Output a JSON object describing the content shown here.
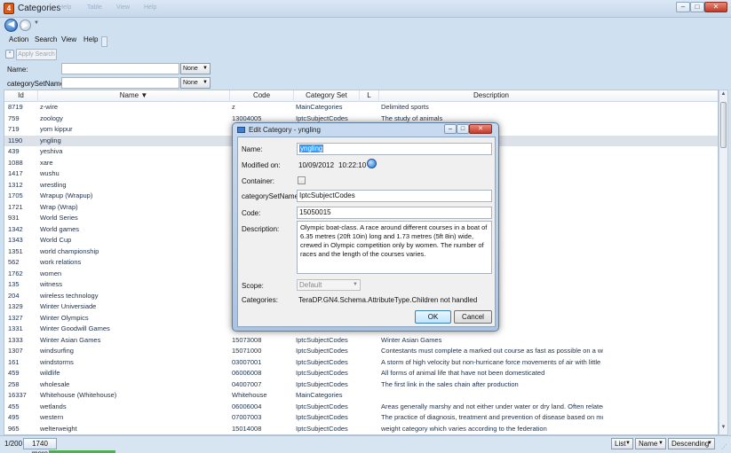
{
  "window": {
    "title": "Categories",
    "ghost_menu": [
      "Action",
      "Help",
      "Table",
      "View",
      "Help"
    ],
    "minimize": "–",
    "maximize": "□",
    "close": "✕"
  },
  "nav": {
    "back": "◀",
    "forward": "▶",
    "dropdown": "▼"
  },
  "menu": [
    "Action",
    "Search",
    "View",
    "Help"
  ],
  "filter": {
    "collapse": "^",
    "apply_label": "Apply Search",
    "name_label": "Name:",
    "name_mode": "None",
    "setname_label": "categorySetName:",
    "setname_mode": "None"
  },
  "grid": {
    "headers": {
      "id": "Id",
      "name": "Name ▼",
      "code": "Code",
      "set": "Category Set",
      "l": "L",
      "desc": "Description"
    },
    "rows": [
      {
        "id": "8719",
        "name": "z-wire",
        "code": "z",
        "set": "MainCategories",
        "desc": "Delimited sports"
      },
      {
        "id": "759",
        "name": "zoology",
        "code": "13004005",
        "set": "IptcSubjectCodes",
        "desc": "The study of animals"
      },
      {
        "id": "719",
        "name": "yom kippur",
        "code": "",
        "set": "",
        "desc": "observed on the 10th day of the lu"
      },
      {
        "id": "1190",
        "name": "yngling",
        "code": "",
        "set": "",
        "desc": "t courses in a boat of 6.35 metres (",
        "sel": true
      },
      {
        "id": "439",
        "name": "yeshiva",
        "code": "",
        "set": "",
        "desc": ""
      },
      {
        "id": "1088",
        "name": "xare",
        "code": "",
        "set": "",
        "desc": "d in a trinquet by teams of 2 player"
      },
      {
        "id": "1417",
        "name": "wushu",
        "code": "",
        "set": "",
        "desc": "Programme of National Sports Fest"
      },
      {
        "id": "1312",
        "name": "wrestling",
        "code": "",
        "set": "",
        "desc": "s to win over his adversary, by hol"
      },
      {
        "id": "1705",
        "name": "Wrapup (Wrapup)",
        "code": "",
        "set": "",
        "desc": "tory (such as the end of the day)."
      },
      {
        "id": "1721",
        "name": "Wrap (Wrap)",
        "code": "",
        "set": "",
        "desc": "of the event."
      },
      {
        "id": "931",
        "name": "World Series",
        "code": "",
        "set": "",
        "desc": "n the top two teams of Major Leag"
      },
      {
        "id": "1342",
        "name": "World games",
        "code": "",
        "set": "",
        "desc": ""
      },
      {
        "id": "1343",
        "name": "World Cup",
        "code": "",
        "set": "",
        "desc": "five continents"
      },
      {
        "id": "1351",
        "name": "world championship",
        "code": "",
        "set": "",
        "desc": "the five continents take part"
      },
      {
        "id": "562",
        "name": "work relations",
        "code": "",
        "set": "",
        "desc": "and labour"
      },
      {
        "id": "1762",
        "name": "women",
        "code": "",
        "set": "",
        "desc": ""
      },
      {
        "id": "135",
        "name": "witness",
        "code": "",
        "set": "",
        "desc": ""
      },
      {
        "id": "204",
        "name": "wireless technology",
        "code": "",
        "set": "",
        "desc": "ns other than point-to-point wired l"
      },
      {
        "id": "1329",
        "name": "Winter Universiade",
        "code": "",
        "set": "",
        "desc": ""
      },
      {
        "id": "1327",
        "name": "Winter Olympics",
        "code": "",
        "set": "",
        "desc": ""
      },
      {
        "id": "1331",
        "name": "Winter Goodwill Games",
        "code": "",
        "set": "",
        "desc": ""
      },
      {
        "id": "1333",
        "name": "Winter Asian Games",
        "code": "15073008",
        "set": "IptcSubjectCodes",
        "desc": "Winter Asian Games"
      },
      {
        "id": "1307",
        "name": "windsurfing",
        "code": "15071000",
        "set": "IptcSubjectCodes",
        "desc": "Contestants must complete a marked out course as fast as possible on a wind"
      },
      {
        "id": "161",
        "name": "windstorms",
        "code": "03007001",
        "set": "IptcSubjectCodes",
        "desc": "A storm of high velocity but non-hurricane force movements of air with little"
      },
      {
        "id": "459",
        "name": "wildlife",
        "code": "06006008",
        "set": "IptcSubjectCodes",
        "desc": "All forms of animal life that have not been domesticated"
      },
      {
        "id": "258",
        "name": "wholesale",
        "code": "04007007",
        "set": "IptcSubjectCodes",
        "desc": "The first link in the sales chain after production"
      },
      {
        "id": "16337",
        "name": "Whitehouse (Whitehouse)",
        "code": "Whitehouse",
        "set": "MainCategories",
        "desc": ""
      },
      {
        "id": "455",
        "name": "wetlands",
        "code": "06006004",
        "set": "IptcSubjectCodes",
        "desc": "Areas generally marshy and not either under water or dry land. Often related"
      },
      {
        "id": "495",
        "name": "western",
        "code": "07007003",
        "set": "IptcSubjectCodes",
        "desc": "The practice of diagnosis, treatment and prevention of disease based on mod"
      },
      {
        "id": "965",
        "name": "welterweight",
        "code": "15014008",
        "set": "IptcSubjectCodes",
        "desc": "weight category which varies according to the federation"
      }
    ]
  },
  "status": {
    "count": "1/200",
    "more": "1740 more",
    "view": "List",
    "sort_field": "Name",
    "sort_order": "Descending"
  },
  "dialog": {
    "title": "Edit Category - yngling",
    "name_label": "Name:",
    "name_value": "yngling",
    "modified_label": "Modified on:",
    "modified_date": "10/09/2012",
    "modified_time": "10:22:10",
    "container_label": "Container:",
    "setname_label": "categorySetName:",
    "setname_value": "IptcSubjectCodes",
    "code_label": "Code:",
    "code_value": "15050015",
    "description_label": "Description:",
    "description_value": "Olympic boat-class. A race around different courses in a boat of 6.35 metres (20ft 10in) long and 1.73 metres (5ft 8in) wide, crewed in Olympic competition only by women. The number of races and the length of the courses varies.",
    "scope_label": "Scope:",
    "scope_value": "Default",
    "categories_label": "Categories:",
    "categories_value": "TeraDP.GN4.Schema.AttributeType.Children not handled",
    "ok_label": "OK",
    "cancel_label": "Cancel",
    "minimize": "–",
    "maximize": "□",
    "close": "✕"
  }
}
